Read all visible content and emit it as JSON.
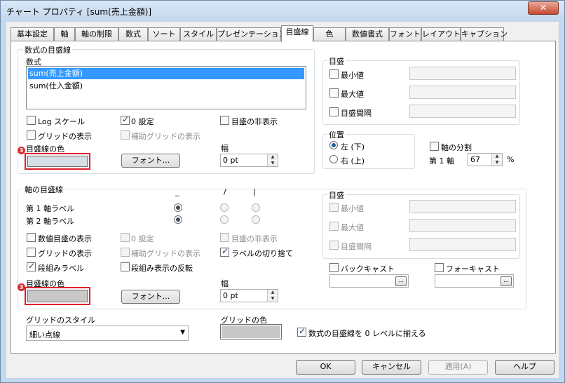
{
  "window": {
    "title": "チャート プロパティ [sum(売上金額)]",
    "close_glyph": "✕"
  },
  "tabs": [
    {
      "label": "基本設定"
    },
    {
      "label": "軸"
    },
    {
      "label": "軸の制限"
    },
    {
      "label": "数式"
    },
    {
      "label": "ソート"
    },
    {
      "label": "スタイル"
    },
    {
      "label": "プレゼンテーション"
    },
    {
      "label": "目盛線"
    },
    {
      "label": "色"
    },
    {
      "label": "数値書式"
    },
    {
      "label": "フォント"
    },
    {
      "label": "レイアウト"
    },
    {
      "label": "キャプション"
    }
  ],
  "expr_grid": {
    "group_title": "数式の目盛線",
    "list_label": "数式",
    "list_items": [
      "sum(売上金額)",
      "sum(仕入金額)"
    ],
    "log_scale": "Log スケール",
    "zero_setting": "0 設定",
    "hide_gridlines": "目盛の非表示",
    "show_grid": "グリッドの表示",
    "show_minor_grid": "補助グリッドの表示",
    "grid_color_label": "目盛線の色",
    "font_button": "フォント...",
    "width_label": "幅",
    "width_value": "0 pt",
    "scale_group": "目盛",
    "min_label": "最小値",
    "max_label": "最大値",
    "interval_label": "目盛間隔",
    "position_group": "位置",
    "left_label": "左 (下)",
    "right_label": "右 (上)",
    "split_axis": "軸の分割",
    "first_axis": "第 1 軸",
    "split_value": "67",
    "percent": "%"
  },
  "dim_grid": {
    "group_title": "軸の目盛線",
    "col_headers": [
      "_",
      "/",
      "|"
    ],
    "axis1_label": "第 1 軸ラベル",
    "axis2_label": "第 2 軸ラベル",
    "show_numeric": "数値目盛の表示",
    "zero_setting": "0 設定",
    "hide_gridlines": "目盛の非表示",
    "show_grid": "グリッドの表示",
    "show_minor_grid": "補助グリッドの表示",
    "truncate_labels": "ラベルの切り捨て",
    "stagger_labels": "段組みラベル",
    "reverse_stagger": "段組み表示の反転",
    "grid_color_label": "目盛線の色",
    "font_button": "フォント...",
    "width_label": "幅",
    "width_value": "0 pt",
    "scale_group": "目盛",
    "min_label": "最小値",
    "max_label": "最大値",
    "interval_label": "目盛間隔",
    "backcast": "バックキャスト",
    "forecast": "フォーキャスト",
    "dots": "..."
  },
  "bottom": {
    "grid_style_label": "グリッドのスタイル",
    "grid_style_value": "細い点線",
    "grid_color_label": "グリッドの色",
    "align_zero": "数式の目盛線を 0 レベルに揃える"
  },
  "buttons": {
    "ok": "OK",
    "cancel": "キャンセル",
    "apply": "適用(A)",
    "help": "ヘルプ"
  },
  "marker_glyph": "3",
  "colors": {
    "highlight_border": "#e0202c",
    "selection": "#3399ff",
    "window_frame": "#c3d8ee"
  }
}
